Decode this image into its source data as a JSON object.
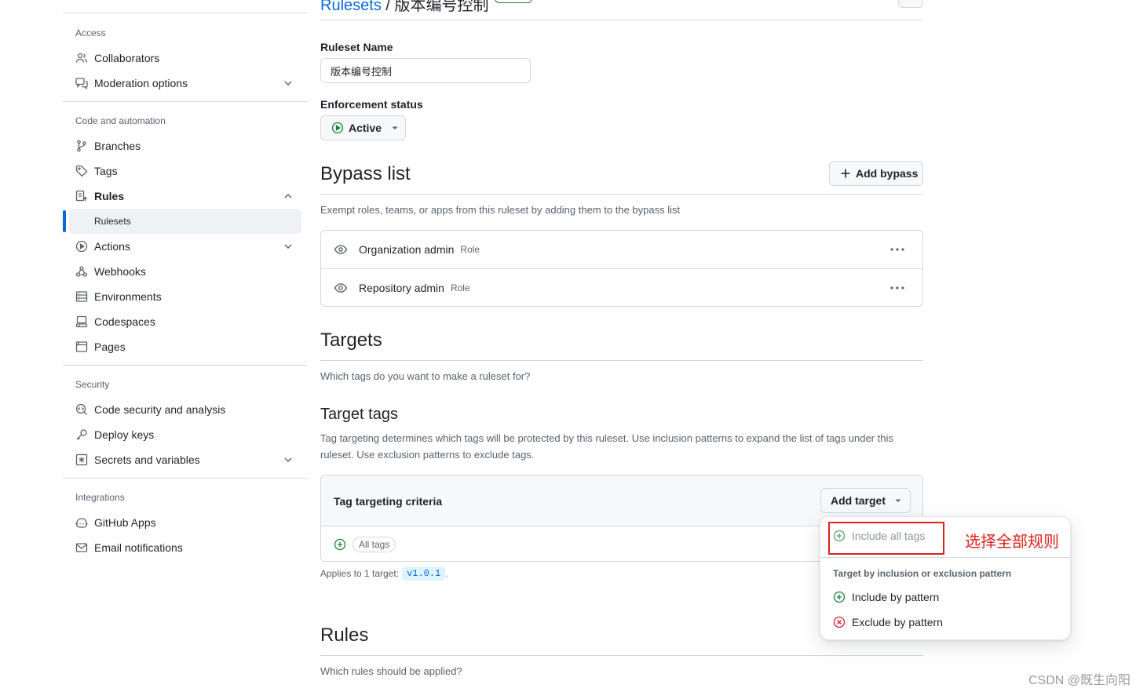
{
  "sidebar": {
    "access": {
      "title": "Access",
      "items": [
        {
          "label": "Collaborators"
        },
        {
          "label": "Moderation options"
        }
      ]
    },
    "code_automation": {
      "title": "Code and automation",
      "items": [
        {
          "label": "Branches"
        },
        {
          "label": "Tags"
        },
        {
          "label": "Rules"
        },
        {
          "label": "Rulesets"
        },
        {
          "label": "Actions"
        },
        {
          "label": "Webhooks"
        },
        {
          "label": "Environments"
        },
        {
          "label": "Codespaces"
        },
        {
          "label": "Pages"
        }
      ]
    },
    "security": {
      "title": "Security",
      "items": [
        {
          "label": "Code security and analysis"
        },
        {
          "label": "Deploy keys"
        },
        {
          "label": "Secrets and variables"
        }
      ]
    },
    "integrations": {
      "title": "Integrations",
      "items": [
        {
          "label": "GitHub Apps"
        },
        {
          "label": "Email notifications"
        }
      ]
    }
  },
  "breadcrumb": {
    "parent": "Rulesets",
    "separator": " / ",
    "current": "版本编号控制"
  },
  "ruleset_name": {
    "label": "Ruleset Name",
    "value": "版本编号控制"
  },
  "enforcement": {
    "label": "Enforcement status",
    "value": "Active",
    "color": "#1a7f37"
  },
  "bypass": {
    "title": "Bypass list",
    "add_button": "Add bypass",
    "description": "Exempt roles, teams, or apps from this ruleset by adding them to the bypass list",
    "rows": [
      {
        "name": "Organization admin",
        "type": "Role"
      },
      {
        "name": "Repository admin",
        "type": "Role"
      }
    ]
  },
  "targets": {
    "title": "Targets",
    "description": "Which tags do you want to make a ruleset for?",
    "tags_title": "Target tags",
    "tags_description": "Tag targeting determines which tags will be protected by this ruleset. Use inclusion patterns to expand the list of tags under this ruleset. Use exclusion patterns to exclude tags.",
    "criteria_title": "Tag targeting criteria",
    "add_target_button": "Add target",
    "criteria_chip": "All tags",
    "applies_prefix": "Applies to 1 target:",
    "applies_target": "v1.0.1",
    "applies_suffix": "."
  },
  "dropdown": {
    "include_all": "Include all tags",
    "group_title": "Target by inclusion or exclusion pattern",
    "include_pattern": "Include by pattern",
    "exclude_pattern": "Exclude by pattern",
    "include_color": "#1a7f37",
    "exclude_color": "#cf222e"
  },
  "rules": {
    "title": "Rules",
    "description": "Which rules should be applied?"
  },
  "annotation": {
    "text": "选择全部规则",
    "color": "#e0211c"
  },
  "watermark": "CSDN @既生向阳"
}
